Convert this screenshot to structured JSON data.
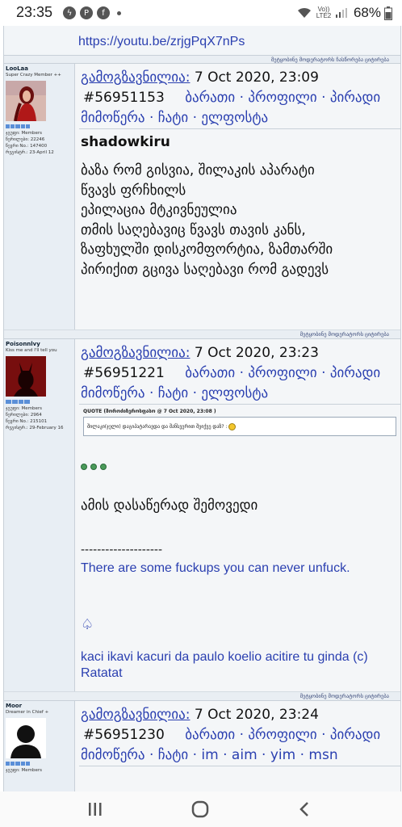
{
  "status_bar": {
    "time": "23:35",
    "network": "Vo)) LTE2",
    "battery": "68%"
  },
  "forum": {
    "top_link": "https://youtu.be/zrjgPqX7nPs",
    "top_footer": "მეტყობინე მოდერატორს   ჩასწორება   ციტირება",
    "labels": {
      "posted": "გამოგზავნილია:",
      "map": "ბარათი",
      "profile": "პროფილი",
      "pm1": "პირადი",
      "pm2": "მიმოწერა",
      "chat": "ჩატი",
      "email": "ელფოსტა",
      "sep": "·"
    },
    "posts": [
      {
        "username": "LooLaa",
        "user_title": "Super Crazy Member ++",
        "group": "ჯგუფი: Members",
        "posts": "წერილები: 22246",
        "number": "წევრი No.: 147400",
        "joined": "რეგისტრ.: 23-April 12",
        "date": "7 Oct 2020, 23:09",
        "post_id": "#56951153",
        "quoted_name": "shadowkiru",
        "lines": [
          "ბაზა რომ გისვია, შილაკის აპარატი",
          "წვავს ფრჩხილს",
          "ეპილაცია მტკივნეულია",
          "თმის საღებავიც წვავს თავის კანს,",
          "ზაფხულში დისკომფორტია, ზამთარში",
          "პირიქით გცივა საღებავი რომ გადევს"
        ],
        "footer": "მეტყობინე მოდერატორს   ციტირება"
      },
      {
        "username": "Poisonnlvy",
        "user_title": "Kiss me and I'll tell you",
        "group": "ჯგუფი: Members",
        "posts": "წერილები: 2964",
        "number": "წევრი No.: 215101",
        "joined": "რეგისტრ.: 29-February 16",
        "date": "7 Oct 2020, 23:23",
        "post_id": "#56951221",
        "quote_header": "QUOTE (შოროძიზეროსფასო @ 7 Oct 2020, 23:08 )",
        "quote_text": "შილაკი(ჯელი) დაგიპატარავდა და შანსვერით შვიქვე დაზ? :",
        "text": "ამის დასაწერად შემოვედი",
        "dashes": "--------------------",
        "sig1": "There are some fuckups you can never unfuck.",
        "spade": "♤",
        "sig2": "kaci ikavi kacuri da paulo koelio acitire tu ginda (c)",
        "sig3": "Ratatat",
        "footer": "მეტყობინე მოდერატორს   ციტირება"
      },
      {
        "username": "Moor",
        "user_title": "Dreamer in Chief +",
        "group": "ჯგუფი: Members",
        "date": "7 Oct 2020, 23:24",
        "post_id": "#56951230",
        "extra_links": [
          "im",
          "aim",
          "yim",
          "msn"
        ]
      }
    ]
  },
  "nav": {
    "recent": "|||",
    "home": "◯",
    "back": "‹"
  }
}
